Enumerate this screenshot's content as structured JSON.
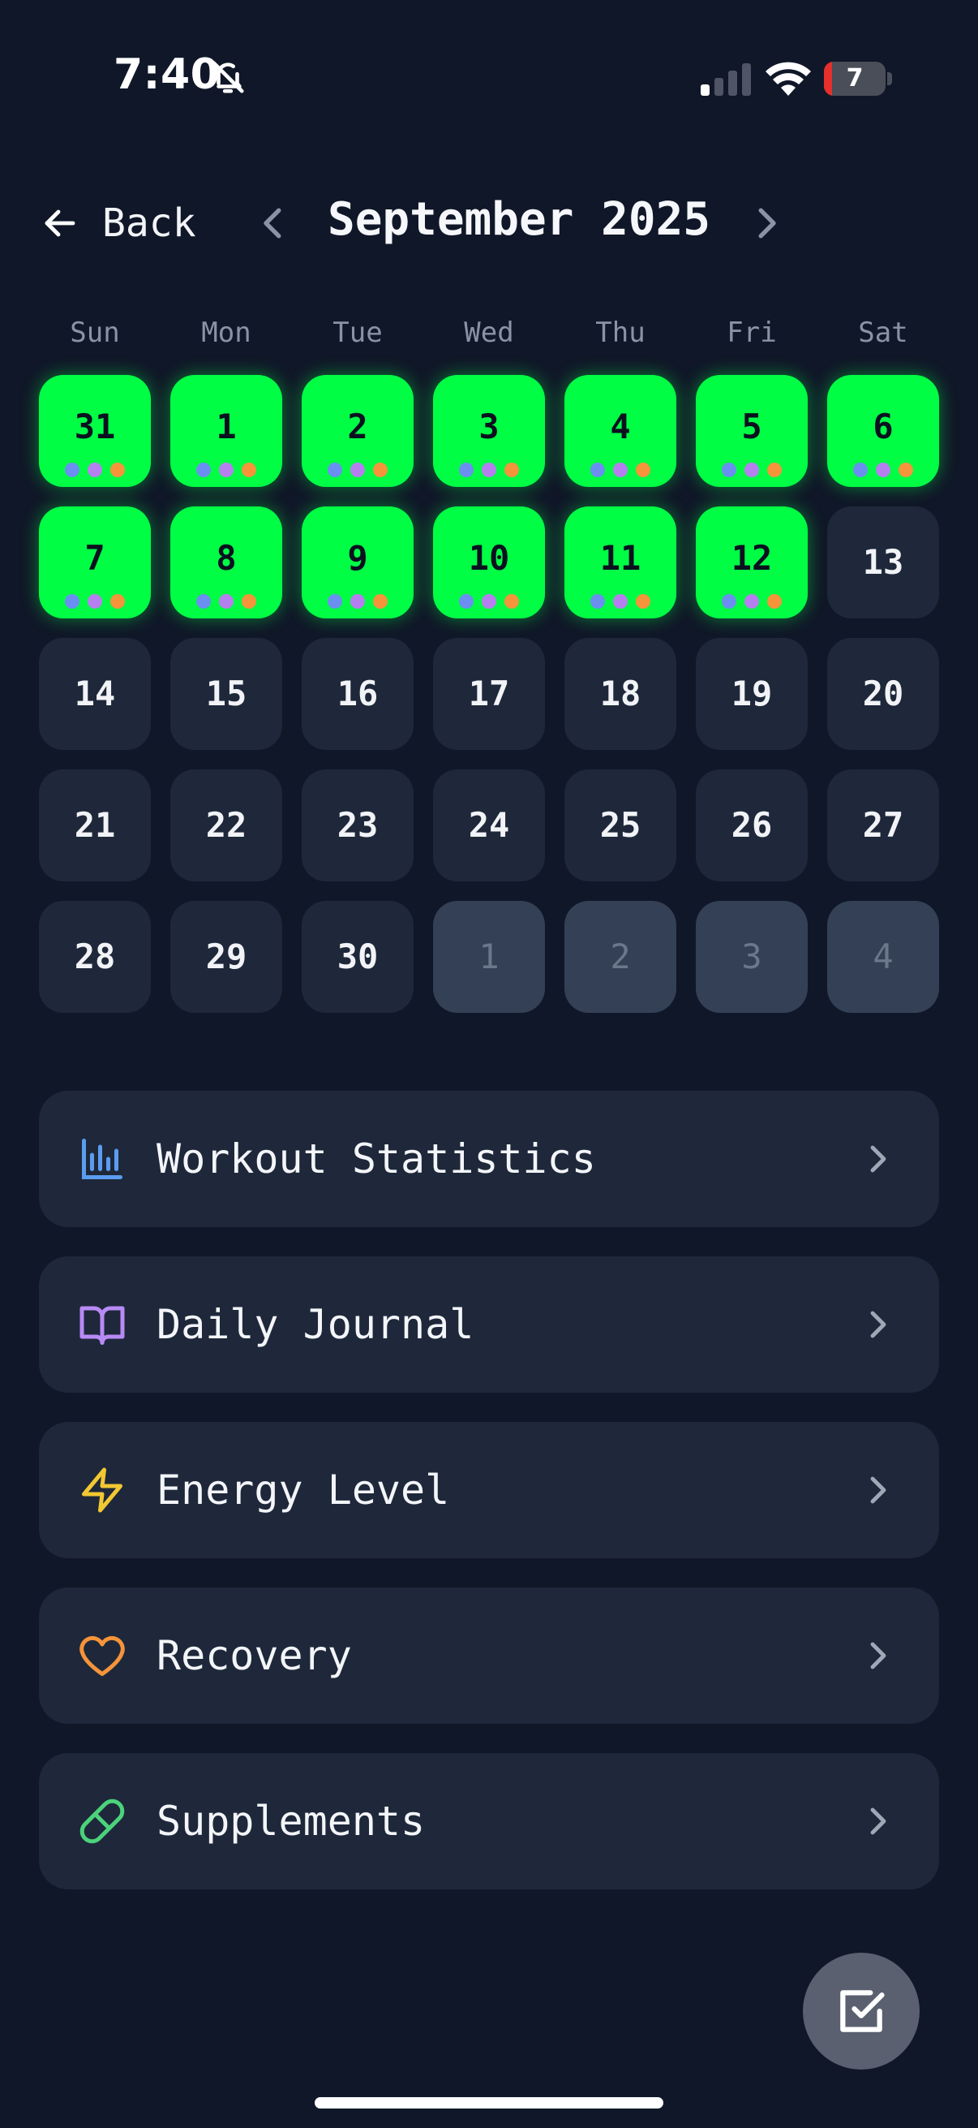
{
  "status_bar": {
    "time": "7:40",
    "battery": "7",
    "battery_level": 0.07
  },
  "header": {
    "back_label": "Back",
    "month_title": "September 2025"
  },
  "weekdays": [
    "Sun",
    "Mon",
    "Tue",
    "Wed",
    "Thu",
    "Fri",
    "Sat"
  ],
  "calendar": {
    "weeks": [
      [
        {
          "d": "31",
          "state": "active"
        },
        {
          "d": "1",
          "state": "active"
        },
        {
          "d": "2",
          "state": "active"
        },
        {
          "d": "3",
          "state": "active"
        },
        {
          "d": "4",
          "state": "active"
        },
        {
          "d": "5",
          "state": "active"
        },
        {
          "d": "6",
          "state": "active"
        }
      ],
      [
        {
          "d": "7",
          "state": "active"
        },
        {
          "d": "8",
          "state": "active"
        },
        {
          "d": "9",
          "state": "active"
        },
        {
          "d": "10",
          "state": "active"
        },
        {
          "d": "11",
          "state": "active"
        },
        {
          "d": "12",
          "state": "active"
        },
        {
          "d": "13",
          "state": "normal"
        }
      ],
      [
        {
          "d": "14",
          "state": "normal"
        },
        {
          "d": "15",
          "state": "normal"
        },
        {
          "d": "16",
          "state": "normal"
        },
        {
          "d": "17",
          "state": "normal"
        },
        {
          "d": "18",
          "state": "normal"
        },
        {
          "d": "19",
          "state": "normal"
        },
        {
          "d": "20",
          "state": "normal"
        }
      ],
      [
        {
          "d": "21",
          "state": "normal"
        },
        {
          "d": "22",
          "state": "normal"
        },
        {
          "d": "23",
          "state": "normal"
        },
        {
          "d": "24",
          "state": "normal"
        },
        {
          "d": "25",
          "state": "normal"
        },
        {
          "d": "26",
          "state": "normal"
        },
        {
          "d": "27",
          "state": "normal"
        }
      ],
      [
        {
          "d": "28",
          "state": "normal"
        },
        {
          "d": "29",
          "state": "normal"
        },
        {
          "d": "30",
          "state": "normal"
        },
        {
          "d": "1",
          "state": "outside"
        },
        {
          "d": "2",
          "state": "outside"
        },
        {
          "d": "3",
          "state": "outside"
        },
        {
          "d": "4",
          "state": "outside"
        }
      ]
    ],
    "dot_colors": [
      "#6b8ff0",
      "#b67ff0",
      "#f5943a"
    ]
  },
  "menu": [
    {
      "label": "Workout Statistics",
      "icon": "bar-chart-icon",
      "color": "#5b9cf0"
    },
    {
      "label": "Daily Journal",
      "icon": "book-icon",
      "color": "#b88af5"
    },
    {
      "label": "Energy Level",
      "icon": "lightning-icon",
      "color": "#f2c832"
    },
    {
      "label": "Recovery",
      "icon": "heart-icon",
      "color": "#f5943a"
    },
    {
      "label": "Supplements",
      "icon": "pill-icon",
      "color": "#4bd37b"
    }
  ],
  "fab": {
    "icon": "checkbox-edit-icon"
  }
}
